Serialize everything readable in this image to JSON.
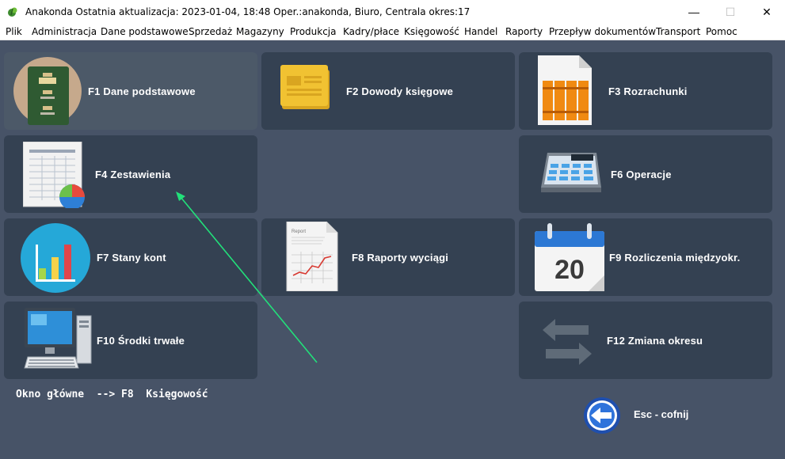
{
  "window": {
    "title": "Anakonda Ostatnia aktualizacja: 2023-01-04, 18:48 Oper.:anakonda, Biuro, Centrala  okres:17",
    "minimize": "—",
    "maximize": "☐",
    "close": "✕"
  },
  "menu": [
    "Plik",
    "Administracja",
    "Dane podstawowe",
    "Sprzedaż",
    "Magazyny",
    "Produkcja",
    "Kadry/płace",
    "Księgowość",
    "Handel",
    "Raporty",
    "Przepływ dokumentów",
    "Transport",
    "Pomoc"
  ],
  "tiles": {
    "f1": "F1  Dane podstawowe",
    "f2": "F2  Dowody księgowe",
    "f3": "F3  Rozrachunki",
    "f4": "F4  Zestawienia",
    "f6": "F6  Operacje",
    "f7": "F7  Stany kont",
    "f8": "F8  Raporty wyciągi",
    "f9": "F9  Rozliczenia międzyokr.",
    "f10": "F10  Środki trwałe",
    "f12": "F12  Zmiana okresu"
  },
  "icons": {
    "f1": "file-cabinet-icon",
    "f2": "document-folder-icon",
    "f3": "binders-icon",
    "f4": "spreadsheet-chart-icon",
    "f6": "calculator-icon",
    "f7": "bar-chart-icon",
    "f8": "report-chart-icon",
    "f9": "calendar-icon",
    "f10": "desktop-computer-icon",
    "f12": "swap-arrows-icon",
    "back": "back-arrow-icon"
  },
  "calendar_day": "20",
  "report_label": "Report",
  "breadcrumb": "Okno główne  --> F8  Księgowość",
  "esc_label": "Esc - cofnij",
  "colors": {
    "background": "#475367",
    "tile": "#344152",
    "tile_highlight": "#4c5968",
    "annotation_arrow": "#22e07a"
  }
}
